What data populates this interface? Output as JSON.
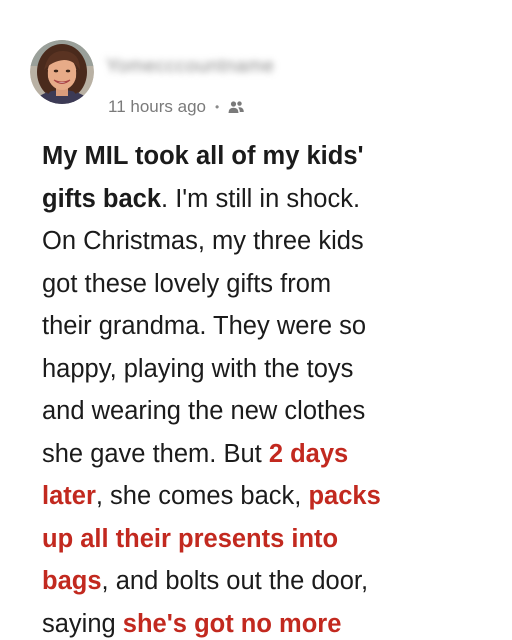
{
  "post": {
    "author_name": "Yomecccountname",
    "timestamp": "11 hours ago",
    "separator": "•",
    "audience_icon": "friends-icon",
    "colors": {
      "text": "#1b1b1b",
      "meta": "#7a7a7a",
      "highlight": "#c2291f"
    },
    "lines": [
      [
        {
          "text": "My MIL took all of my kids'",
          "style": "bold"
        }
      ],
      [
        {
          "text": "gifts back",
          "style": "bold"
        },
        {
          "text": ". I'm still in shock.",
          "style": "normal"
        }
      ],
      [
        {
          "text": "On Christmas, my three kids",
          "style": "normal"
        }
      ],
      [
        {
          "text": "got these lovely gifts from",
          "style": "normal"
        }
      ],
      [
        {
          "text": "their grandma. They were so",
          "style": "normal"
        }
      ],
      [
        {
          "text": "happy, playing with the toys",
          "style": "normal"
        }
      ],
      [
        {
          "text": "and wearing the new clothes",
          "style": "normal"
        }
      ],
      [
        {
          "text": "she gave them. But ",
          "style": "normal"
        },
        {
          "text": "2 days",
          "style": "highlight"
        }
      ],
      [
        {
          "text": "later",
          "style": "highlight"
        },
        {
          "text": ", she comes back, ",
          "style": "normal"
        },
        {
          "text": "packs",
          "style": "highlight"
        }
      ],
      [
        {
          "text": "up all their presents into",
          "style": "highlight"
        }
      ],
      [
        {
          "text": "bags",
          "style": "highlight"
        },
        {
          "text": ", and bolts out the door,",
          "style": "normal"
        }
      ],
      [
        {
          "text": "saying ",
          "style": "normal"
        },
        {
          "text": "she's got no more",
          "style": "highlight"
        }
      ]
    ]
  }
}
